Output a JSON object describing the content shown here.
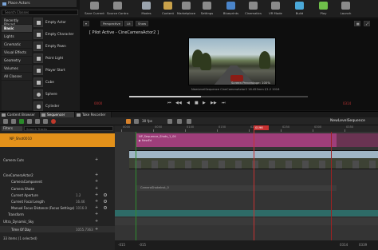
{
  "place_panel": {
    "tab_title": "Place Actors",
    "search_placeholder": "Search Classes",
    "categories": [
      "Recently Placed",
      "Basic",
      "Lights",
      "Cinematic",
      "Visual Effects",
      "Geometry",
      "Volumes",
      "All Classes"
    ],
    "selected_category": "Basic",
    "items": [
      "Empty Actor",
      "Empty Character",
      "Empty Pawn",
      "Point Light",
      "Player Start",
      "Cube",
      "Sphere",
      "Cylinder"
    ]
  },
  "toolbar": {
    "buttons": [
      {
        "label": "Save Current",
        "icon": "save-icon",
        "color": "#8a8a8a"
      },
      {
        "label": "Source Control",
        "icon": "source-control-icon",
        "color": "#8a8a8a"
      },
      {
        "label": "Modes",
        "icon": "modes-icon",
        "color": "#9aa3ad"
      },
      {
        "label": "Content",
        "icon": "content-icon",
        "color": "#c9a14a"
      },
      {
        "label": "Marketplace",
        "icon": "marketplace-icon",
        "color": "#8a8a8a"
      },
      {
        "label": "Settings",
        "icon": "settings-icon",
        "color": "#8a8a8a"
      },
      {
        "label": "Blueprints",
        "icon": "blueprints-icon",
        "color": "#4a84c9"
      },
      {
        "label": "Cinematics",
        "icon": "cinematics-icon",
        "color": "#8a8a8a"
      },
      {
        "label": "VR Mode",
        "icon": "vr-icon",
        "color": "#8a8a8a"
      },
      {
        "label": "Build",
        "icon": "build-icon",
        "color": "#4aa8d8"
      },
      {
        "label": "Play",
        "icon": "play-icon",
        "color": "#6fbf4a"
      },
      {
        "label": "Launch",
        "icon": "launch-icon",
        "color": "#8a8a8a"
      }
    ]
  },
  "viewport": {
    "perspective_label": "Perspective",
    "lit_label": "Lit",
    "show_label": "Show",
    "pilot_title": "[ Pilot Active - CineCameraActor2 ]",
    "info_line1": "Screen Percentage: 100%",
    "info_line2": "NewLevelSequence  CineCameraActor2  16.455mm  f/1.2  1016",
    "time_left": "0000",
    "time_right": "0314"
  },
  "bottom_tabs": [
    "Content Browser",
    "Sequencer",
    "Take Recorder"
  ],
  "active_tab": "Sequencer",
  "sequencer": {
    "fps": "30 fps",
    "sequence_name": "NewLevelSequence",
    "playhead_frame": "0196",
    "filter_label": "Filters",
    "track_search_placeholder": "Search Tracks",
    "ruler_labels": [
      "0000",
      "0050",
      "0100",
      "0150",
      "0200",
      "0250",
      "0300",
      "0350"
    ],
    "tracks": [
      {
        "name": "NP_Shot0010",
        "value": ""
      },
      {
        "name": "Camera Cuts",
        "value": ""
      },
      {
        "name": "CineCameraActor2",
        "value": ""
      },
      {
        "name": "CameraComponent",
        "value": ""
      },
      {
        "name": "Camera Shake",
        "value": ""
      },
      {
        "name": "Current Aperture",
        "value": "1.2"
      },
      {
        "name": "Current Focal Length",
        "value": "16.46"
      },
      {
        "name": "Manual Focus Distance (Focus Settings)",
        "value": "1016.0"
      },
      {
        "name": "Transform",
        "value": ""
      },
      {
        "name": "Ultra_Dynamic_Sky",
        "value": ""
      },
      {
        "name": "Time Of Day",
        "value": "1055.7363"
      }
    ],
    "shot_line1": "NP_Sequence_Shots_1_04",
    "shot_line2": "▶ NewEd",
    "aperture_bar_label": "CameraShakeInst_0",
    "items_count": "33 items (1 selected)",
    "bottom_times": [
      "-015",
      "-015",
      "0314",
      "0339"
    ]
  }
}
